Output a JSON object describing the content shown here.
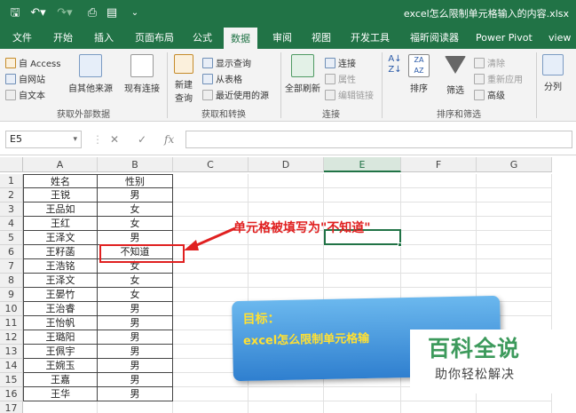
{
  "window": {
    "title": "excel怎么限制单元格输入的内容.xlsx",
    "accent": "#217346",
    "quick_access": [
      "save-icon",
      "undo-icon",
      "redo-icon",
      "print-preview-icon",
      "more-icon"
    ]
  },
  "tabs": [
    "文件",
    "开始",
    "插入",
    "页面布局",
    "公式",
    "数据",
    "审阅",
    "视图",
    "开发工具",
    "福昕阅读器",
    "Power Pivot",
    "view"
  ],
  "active_tab": "数据",
  "ribbon": {
    "get_external": {
      "label": "获取外部数据",
      "access": "自 Access",
      "web": "自网站",
      "text": "自文本",
      "other_sources": "自其他来源",
      "existing_connections": "现有连接"
    },
    "get_transform": {
      "label": "获取和转换",
      "new_query": "新建\n查询",
      "show_queries": "显示查询",
      "from_table": "从表格",
      "recent_sources": "最近使用的源"
    },
    "connections": {
      "label": "连接",
      "refresh_all": "全部刷新",
      "connections": "连接",
      "properties": "属性",
      "edit_links": "编辑链接"
    },
    "sort_filter": {
      "label": "排序和筛选",
      "sort": "排序",
      "filter": "筛选",
      "clear": "清除",
      "reapply": "重新应用",
      "advanced": "高级"
    },
    "data_tools": {
      "split": "分列"
    }
  },
  "formula_bar": {
    "name_box": "E5",
    "cancel": "✕",
    "enter": "✓",
    "fx": "fx",
    "value": ""
  },
  "columns": [
    "A",
    "B",
    "C",
    "D",
    "E",
    "F",
    "G"
  ],
  "selected_column": "E",
  "rows": [
    "1",
    "2",
    "3",
    "4",
    "5",
    "6",
    "7",
    "8",
    "9",
    "10",
    "11",
    "12",
    "13",
    "14",
    "15",
    "16",
    "17"
  ],
  "table": [
    [
      "姓名",
      "性别"
    ],
    [
      "王锐",
      "男"
    ],
    [
      "王品如",
      "女"
    ],
    [
      "王红",
      "女"
    ],
    [
      "王泽文",
      "男"
    ],
    [
      "王籽菡",
      "不知道"
    ],
    [
      "王浩铭",
      "女"
    ],
    [
      "王泽文",
      "女"
    ],
    [
      "王晏竹",
      "女"
    ],
    [
      "王治睿",
      "男"
    ],
    [
      "王怡帆",
      "男"
    ],
    [
      "王璐阳",
      "男"
    ],
    [
      "王佩宇",
      "男"
    ],
    [
      "王婉玉",
      "男"
    ],
    [
      "王嘉",
      "男"
    ],
    [
      "王华",
      "男"
    ]
  ],
  "annotation": {
    "text": "单元格被填写为\"不知道\"",
    "color": "#e02020"
  },
  "callout": {
    "title": "目标：",
    "body": "excel怎么限制单元格输",
    "bg": "#3d8fd8"
  },
  "watermark": {
    "brand": "百科全说",
    "sub": "助你轻松解决"
  }
}
